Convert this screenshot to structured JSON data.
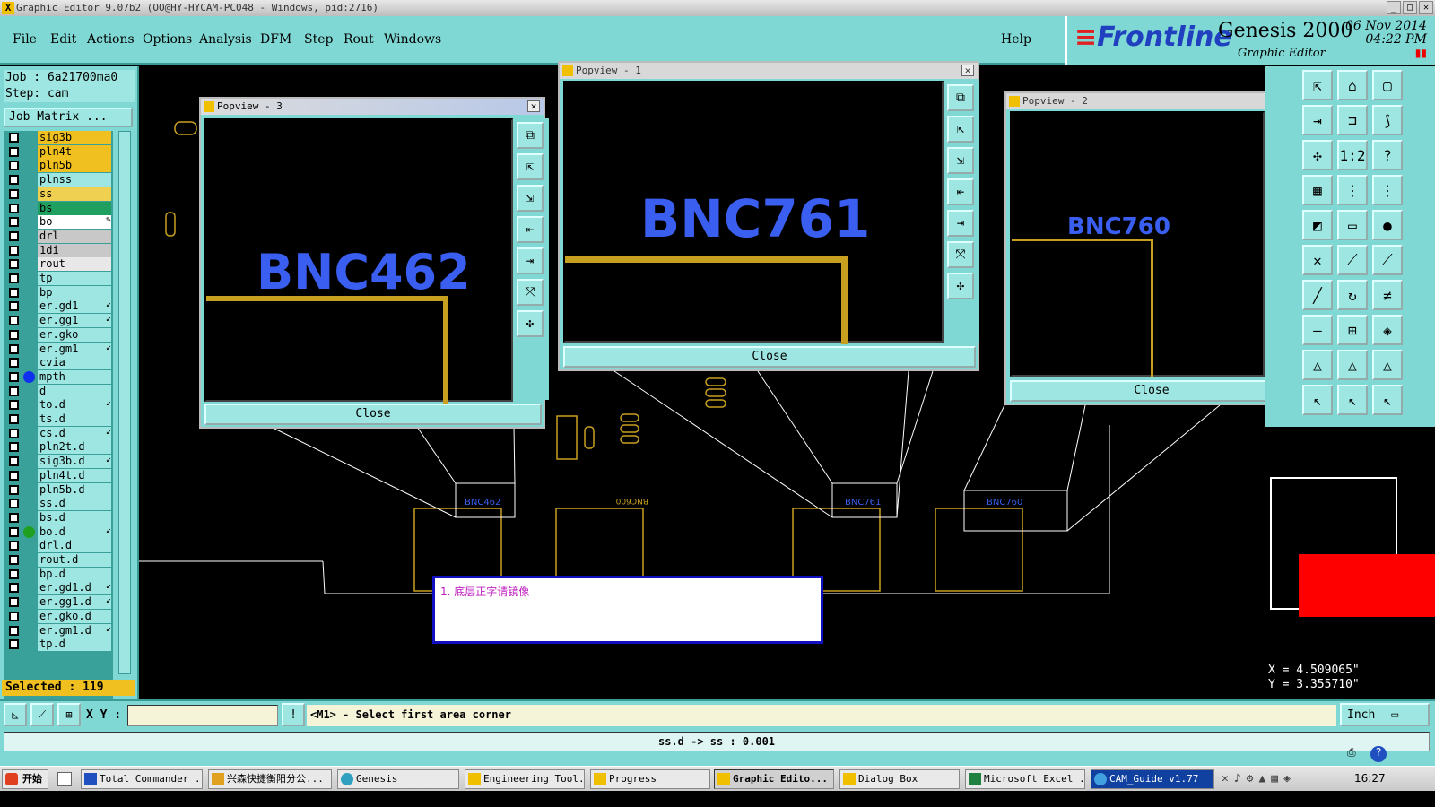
{
  "window": {
    "title": "Graphic Editor 9.07b2 (OO@HY-HYCAM-PC048 - Windows, pid:2716)"
  },
  "menu": [
    "File",
    "Edit",
    "Actions",
    "Options",
    "Analysis",
    "DFM",
    "Step",
    "Rout",
    "Windows"
  ],
  "help_label": "Help",
  "brand": {
    "logo_prefix": "≡",
    "logo": "Frontline",
    "product": "Genesis 2000",
    "subtitle": "Graphic Editor",
    "date_line1": "06 Nov 2014",
    "date_line2": "04:22 PM"
  },
  "job": {
    "job_text": "Job : 6a21700ma0",
    "step_text": "Step: cam",
    "matrix_button": "Job Matrix ..."
  },
  "layers": [
    {
      "name": "sig3b",
      "color": "#f0c020"
    },
    {
      "name": "pln4t",
      "color": "#f0c020"
    },
    {
      "name": "pln5b",
      "color": "#f0c020"
    },
    {
      "name": "plnss",
      "color": "#9ee6e2"
    },
    {
      "name": "ss",
      "color": "#f0d050"
    },
    {
      "name": "bs",
      "color": "#20a060"
    },
    {
      "name": "bo",
      "color": "#ffffff",
      "mark": "✎"
    },
    {
      "name": "drl",
      "color": "#c8c8c8"
    },
    {
      "name": "1di",
      "color": "#c8c8c8"
    },
    {
      "name": "rout",
      "color": "#e8e8e8"
    },
    {
      "name": "tp",
      "color": "#9ee6e2"
    },
    {
      "name": "bp",
      "color": "#9ee6e2"
    },
    {
      "name": "er.gd1",
      "color": "#9ee6e2",
      "mark": "↙"
    },
    {
      "name": "er.gg1",
      "color": "#9ee6e2",
      "mark": "↙"
    },
    {
      "name": "er.gko",
      "color": "#9ee6e2"
    },
    {
      "name": "er.gm1",
      "color": "#9ee6e2",
      "mark": "↙"
    },
    {
      "name": "cvia",
      "color": "#9ee6e2"
    },
    {
      "name": "mpth",
      "color": "#9ee6e2",
      "dot": "#1030f0"
    },
    {
      "name": "d",
      "color": "#9ee6e2"
    },
    {
      "name": "to.d",
      "color": "#9ee6e2",
      "mark": "↙"
    },
    {
      "name": "ts.d",
      "color": "#9ee6e2"
    },
    {
      "name": "cs.d",
      "color": "#9ee6e2",
      "mark": "↙"
    },
    {
      "name": "pln2t.d",
      "color": "#9ee6e2"
    },
    {
      "name": "sig3b.d",
      "color": "#9ee6e2",
      "mark": "↙"
    },
    {
      "name": "pln4t.d",
      "color": "#9ee6e2"
    },
    {
      "name": "pln5b.d",
      "color": "#9ee6e2"
    },
    {
      "name": "ss.d",
      "color": "#9ee6e2"
    },
    {
      "name": "bs.d",
      "color": "#9ee6e2"
    },
    {
      "name": "bo.d",
      "color": "#9ee6e2",
      "dot": "#20a020",
      "mark": "↙"
    },
    {
      "name": "drl.d",
      "color": "#9ee6e2"
    },
    {
      "name": "rout.d",
      "color": "#9ee6e2"
    },
    {
      "name": "bp.d",
      "color": "#9ee6e2"
    },
    {
      "name": "er.gd1.d",
      "color": "#9ee6e2",
      "mark": "↙"
    },
    {
      "name": "er.gg1.d",
      "color": "#9ee6e2",
      "mark": "↙"
    },
    {
      "name": "er.gko.d",
      "color": "#9ee6e2"
    },
    {
      "name": "er.gm1.d",
      "color": "#9ee6e2",
      "mark": "↙"
    },
    {
      "name": "tp.d",
      "color": "#9ee6e2"
    }
  ],
  "selected_text": "Selected : 119",
  "popviews": [
    {
      "title": "Popview - 3",
      "label": "BNC462",
      "close": "Close"
    },
    {
      "title": "Popview - 1",
      "label": "BNC761",
      "close": "Close"
    },
    {
      "title": "Popview - 2",
      "label": "BNC760",
      "close": "Close"
    }
  ],
  "canvas_labels": {
    "bnc462": "BNC462",
    "bnc761": "BNC761",
    "bnc760": "BNC760",
    "bnc600": "BNC600"
  },
  "message": "1. 底层正字请镜像",
  "coords": {
    "x": "X = 4.509065\"",
    "y": "Y = 3.355710\""
  },
  "cmd": {
    "xy_label": "X Y :",
    "xy_value": "",
    "prompt": "<M1> - Select first area corner",
    "unit": "Inch"
  },
  "status_text": "ss.d -> ss : 0.001",
  "taskbar": {
    "start": "开始",
    "items": [
      "Total Commander ...",
      "兴森快捷衡阳分公...",
      "Genesis",
      "Engineering Tool...",
      "Progress",
      "Graphic Edito...",
      "Dialog Box",
      "Microsoft Excel ...",
      "CAM_Guide v1.77"
    ],
    "clock": "16:27"
  }
}
